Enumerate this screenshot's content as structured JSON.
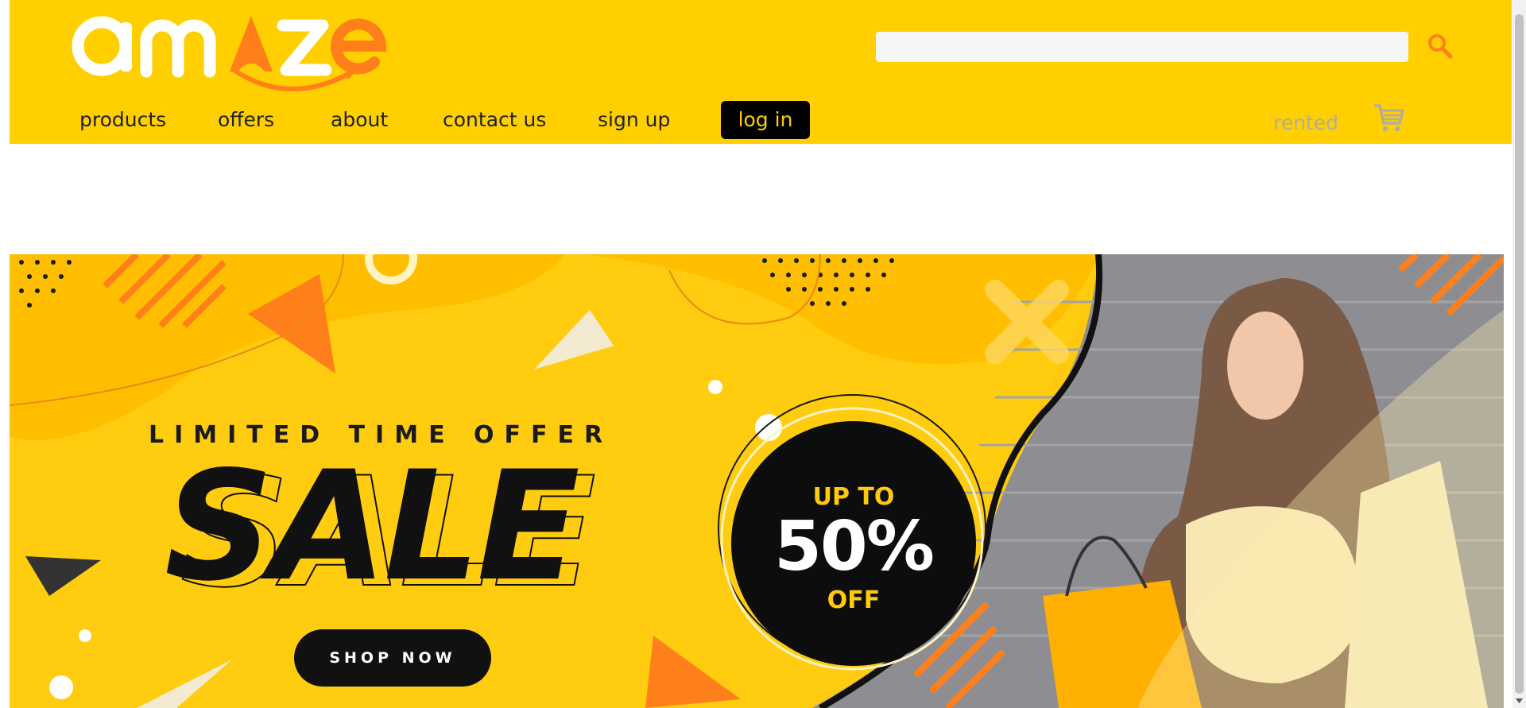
{
  "header": {
    "logo_text": "amaze",
    "search": {
      "value": "",
      "placeholder": ""
    },
    "nav": {
      "products": "products",
      "offers": "offers",
      "about": "about",
      "contact": "contact us",
      "signup": "sign up",
      "login": "log in"
    },
    "rented_label": "rented",
    "icons": {
      "search": "search-icon",
      "cart": "cart-icon"
    }
  },
  "banner": {
    "headline": "LIMITED TIME OFFER",
    "sale": "SALE",
    "shop_now": "SHOP NOW",
    "badge": {
      "up_to": "UP TO",
      "percent": "50%",
      "off": "OFF"
    }
  },
  "colors": {
    "brand_yellow": "#ffcf00",
    "accent_orange": "#ff7f1a",
    "banner_yellow": "#ffc90e",
    "dark": "#111111"
  }
}
